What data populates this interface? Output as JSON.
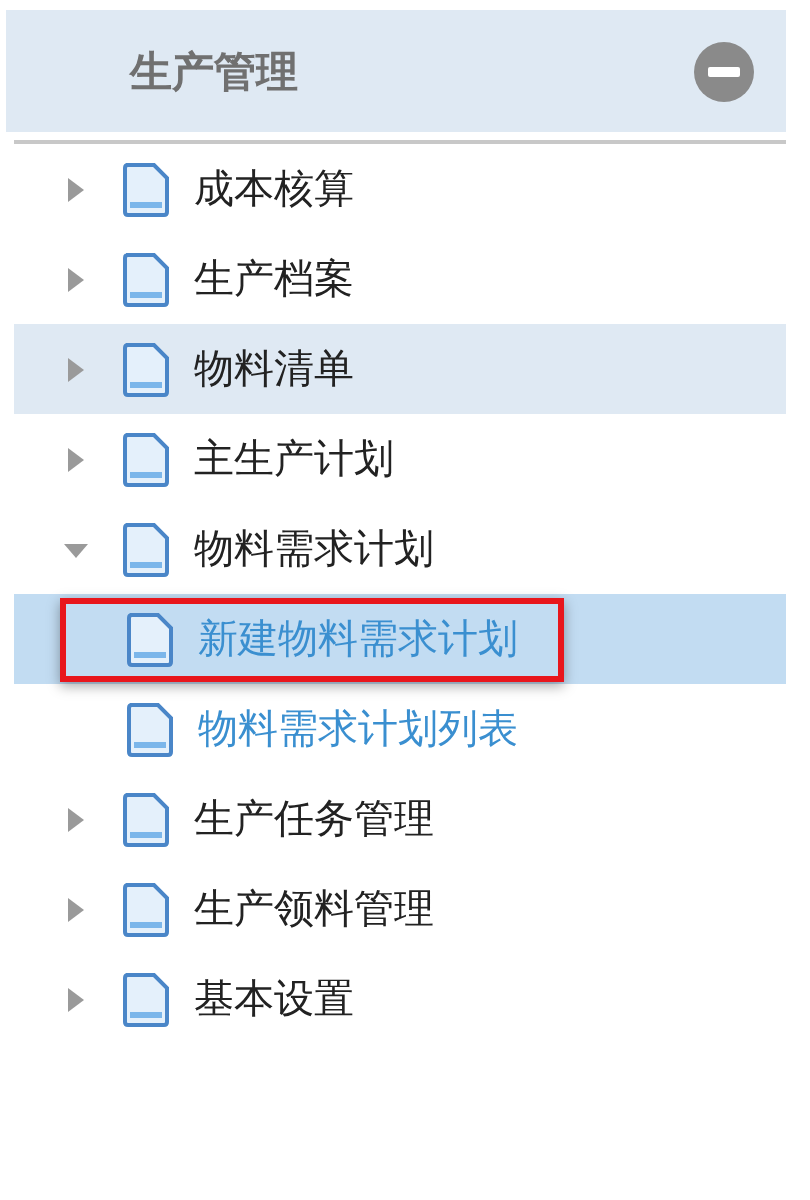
{
  "panel": {
    "title": "生产管理",
    "collapsed": false
  },
  "tree": [
    {
      "label": "成本核算",
      "expanded": false,
      "hovered": false
    },
    {
      "label": "生产档案",
      "expanded": false,
      "hovered": false
    },
    {
      "label": "物料清单",
      "expanded": false,
      "hovered": true
    },
    {
      "label": "主生产计划",
      "expanded": false,
      "hovered": false
    },
    {
      "label": "物料需求计划",
      "expanded": true,
      "hovered": false,
      "children": [
        {
          "label": "新建物料需求计划",
          "selected": true,
          "marked": true
        },
        {
          "label": "物料需求计划列表",
          "selected": false,
          "marked": false
        }
      ]
    },
    {
      "label": "生产任务管理",
      "expanded": false,
      "hovered": false
    },
    {
      "label": "生产领料管理",
      "expanded": false,
      "hovered": false
    },
    {
      "label": "基本设置",
      "expanded": false,
      "hovered": false
    }
  ]
}
